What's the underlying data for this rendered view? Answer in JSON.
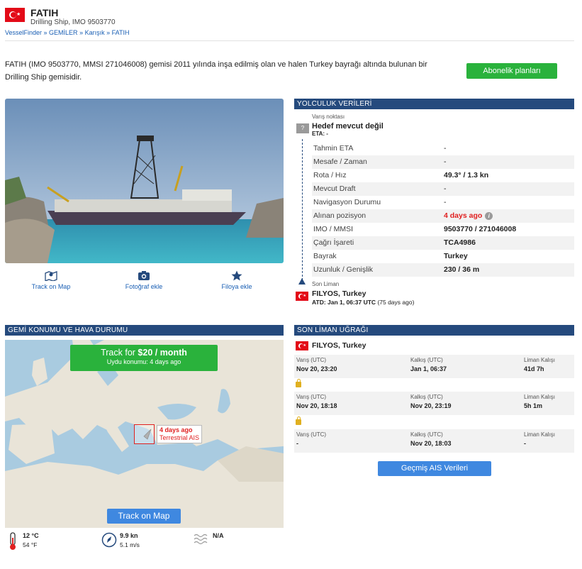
{
  "header": {
    "vessel_name": "FATIH",
    "vessel_type": "Drilling Ship, IMO 9503770",
    "breadcrumb": [
      "VesselFinder",
      "GEMİLER",
      "Karışık",
      "FATIH"
    ]
  },
  "description": "FATIH (IMO 9503770, MMSI 271046008) gemisi 2011 yılında inşa edilmiş olan ve halen Turkey bayrağı altında bulunan bir Drilling Ship gemisidir.",
  "subscribe_label": "Abonelik planları",
  "photo_actions": {
    "track": "Track on Map",
    "photo": "Fotoğraf ekle",
    "fleet": "Filoya ekle"
  },
  "voyage": {
    "section_title": "YOLCULUK VERİLERİ",
    "destination_label": "Varış noktası",
    "destination_value": "Hedef mevcut değil",
    "eta_value": "ETA: -",
    "unknown_badge": "?",
    "rows": [
      {
        "key": "Tahmin ETA",
        "value": "-"
      },
      {
        "key": "Mesafe / Zaman",
        "value": "-"
      },
      {
        "key": "Rota / Hız",
        "value": "49.3° / 1.3 kn"
      },
      {
        "key": "Mevcut Draft",
        "value": "-"
      },
      {
        "key": "Navigasyon Durumu",
        "value": "-"
      },
      {
        "key": "Alınan pozisyon",
        "value": "4 days ago"
      },
      {
        "key": "IMO / MMSI",
        "value": "9503770 / 271046008"
      },
      {
        "key": "Çağrı İşareti",
        "value": "TCA4986"
      },
      {
        "key": "Bayrak",
        "value": "Turkey"
      },
      {
        "key": "Uzunluk / Genişlik",
        "value": "230 / 36 m"
      }
    ],
    "last_port_label": "Son Liman",
    "last_port_name": "FILYOS, Turkey",
    "last_port_atd": "ATD: Jan 1, 06:37 UTC",
    "last_port_ago": "(75 days ago)"
  },
  "map_section": {
    "title": "GEMİ KONUMU VE HAVA DURUMU",
    "track_prefix": "Track for ",
    "track_price": "$20 / month",
    "satellite_pos": "Uydu konumu: 4 days ago",
    "pos_ago": "4 days ago",
    "pos_source": "Terrestrial AIS",
    "track_button": "Track on Map"
  },
  "weather": {
    "temp_c": "12 °C",
    "temp_f": "54 °F",
    "wind_kn": "9.9 kn",
    "wind_ms": "5.1 m/s",
    "waves": "N/A"
  },
  "port_calls": {
    "title": "SON LİMAN UĞRAĞI",
    "port_name": "FILYOS, Turkey",
    "col_arrival": "Varış (UTC)",
    "col_departure": "Kalkış (UTC)",
    "col_stay": "Liman Kalışı",
    "rows": [
      {
        "arrival": "Nov 20, 23:20",
        "departure": "Jan 1, 06:37",
        "stay": "41d 7h"
      },
      {
        "arrival": "Nov 20, 18:18",
        "departure": "Nov 20, 23:19",
        "stay": "5h 1m"
      },
      {
        "arrival": "-",
        "departure": "Nov 20, 18:03",
        "stay": "-"
      }
    ],
    "ais_button": "Geçmiş AIS Verileri"
  },
  "colors": {
    "accent_green": "#2ab23c",
    "section_navy": "#254a7d",
    "button_blue": "#3f88e0",
    "alert_red": "#e02020",
    "flag_red": "#e30a17"
  }
}
